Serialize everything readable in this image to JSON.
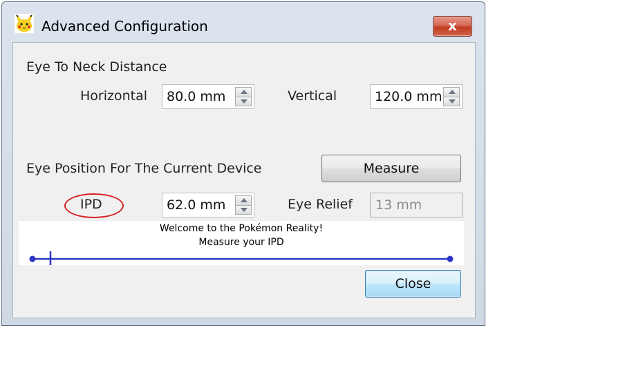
{
  "window": {
    "title": "Advanced Configuration",
    "close_glyph": "x"
  },
  "eye_to_neck": {
    "section_label": "Eye To Neck Distance",
    "horizontal_label": "Horizontal",
    "horizontal_value": "80.0 mm",
    "vertical_label": "Vertical",
    "vertical_value": "120.0 mm"
  },
  "eye_position": {
    "section_label": "Eye Position For The Current Device",
    "measure_label": "Measure",
    "ipd_label": "IPD",
    "ipd_value": "62.0 mm",
    "eye_relief_label": "Eye Relief",
    "eye_relief_value": "13 mm"
  },
  "measure_panel": {
    "line1": "Welcome to the Pokémon Reality!",
    "line2": "Measure your IPD"
  },
  "footer": {
    "close_label": "Close"
  },
  "colors": {
    "highlight_oval": "#d92020",
    "measure_line": "#2b35c4",
    "close_button_red": "#c13c22"
  },
  "icons": {
    "app": "pikachu-icon",
    "spin_up": "arrow-up-icon",
    "spin_down": "arrow-down-icon"
  }
}
